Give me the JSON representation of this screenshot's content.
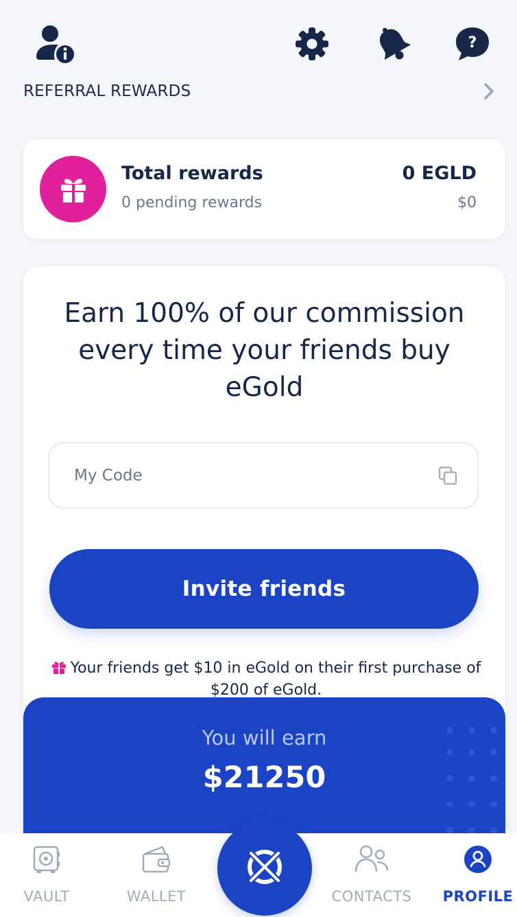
{
  "colors": {
    "primary": "#1b44c4",
    "gift_pink": "#e0219b",
    "text_dark": "#16274a",
    "text_muted": "#6b778e",
    "nav_inactive": "#a1abbe",
    "background": "#f5f6fa"
  },
  "topbar": {
    "icons": [
      "user-info-icon",
      "gear-icon",
      "bell-icon",
      "help-chat-icon"
    ]
  },
  "referral": {
    "title": "REFERRAL REWARDS"
  },
  "rewards": {
    "title": "Total rewards",
    "pending": "0 pending rewards",
    "amount": "0 EGLD",
    "usd": "$0"
  },
  "earn_card": {
    "heading": "Earn 100% of our commission every time your friends buy eGold",
    "code_placeholder": "My Code",
    "invite_label": "Invite friends",
    "note": "Your friends get $10 in eGold on their first purchase of $200 of eGold."
  },
  "earn_panel": {
    "label": "You will earn",
    "value": "$21250"
  },
  "bottom_nav": {
    "items": [
      {
        "label": "VAULT",
        "icon": "vault-icon"
      },
      {
        "label": "WALLET",
        "icon": "wallet-icon"
      },
      {
        "label": "CONTACTS",
        "icon": "contacts-icon"
      },
      {
        "label": "PROFILE",
        "icon": "profile-icon",
        "active": true
      }
    ],
    "center_icon": "elrond-logo-icon"
  }
}
